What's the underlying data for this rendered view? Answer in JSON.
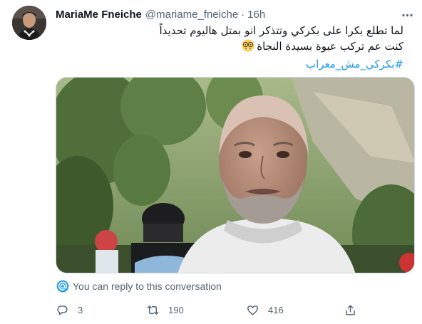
{
  "tweet": {
    "author_name": "MariaMe Fneiche",
    "handle": "@mariame_fneiche",
    "separator": "·",
    "time": "16h",
    "text_line_1": "لما تطلع بكرا على بكركي وتتذكر انو بمتل هاليوم تحديداً",
    "text_line_2": "كنت عم تركب عبوة بسيدة النجاة",
    "hashtag": "#بكركي_مش_معراب",
    "emoji": "nerd-face-emoji"
  },
  "reply_notice": {
    "text": "You can reply to this conversation",
    "icon": "at-sign-icon"
  },
  "actions": {
    "reply_count": "3",
    "retweet_count": "190",
    "like_count": "416"
  },
  "colors": {
    "accent": "#1d9bf0",
    "secondary_text": "#536471",
    "primary_text": "#0f1419",
    "emoji_yellow": "#ffcc4d"
  }
}
